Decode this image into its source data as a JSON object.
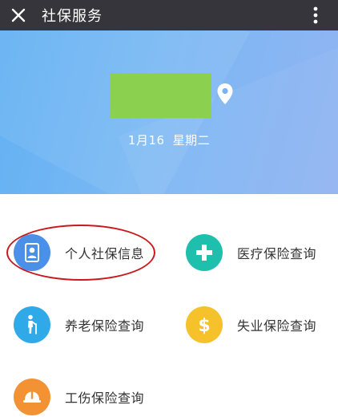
{
  "header": {
    "title": "社保服务"
  },
  "banner": {
    "date": "1月16",
    "weekday": "星期二"
  },
  "menu": {
    "personal_info": "个人社保信息",
    "medical": "医疗保险查询",
    "pension": "养老保险查询",
    "unemployment": "失业保险查询",
    "injury": "工伤保险查询"
  },
  "colors": {
    "topbar": "#35353b",
    "personal_icon_bg": "#4a90e8",
    "medical_icon_bg": "#1fbfae",
    "pension_icon_bg": "#2fa9e8",
    "unemployment_icon_bg": "#f5c22c",
    "injury_icon_bg": "#f39233",
    "highlight_ellipse": "#c9191c"
  }
}
